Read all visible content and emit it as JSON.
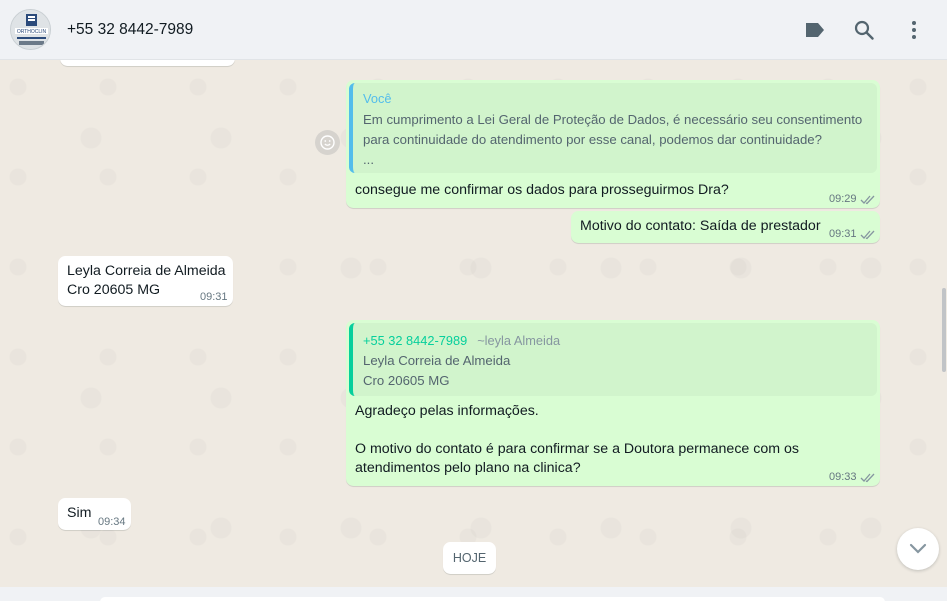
{
  "header": {
    "contact": "+55 32 8442-7989",
    "avatar_text": "ORTHOCLIN"
  },
  "messages": [
    {
      "quote_author": "Você",
      "quote_line1": "Em cumprimento a Lei Geral de Proteção de Dados, é necessário seu consentimento",
      "quote_line2": "para continuidade do atendimento por esse canal, podemos dar continuidade?",
      "quote_line3": "...",
      "text": "consegue me confirmar os dados para prosseguirmos Dra?",
      "time": "09:29"
    },
    {
      "text": "Motivo do contato: Saída de prestador",
      "time": "09:31"
    },
    {
      "line1": "Leyla Correia de Almeida",
      "line2": "Cro 20605 MG",
      "time": "09:31"
    },
    {
      "quote_author": "+55 32 8442-7989",
      "quote_sub": "~leyla Almeida",
      "quote_line1": "Leyla Correia de Almeida",
      "quote_line2": "Cro 20605 MG",
      "line1": "Agradeço pelas informações.",
      "line2": "O motivo do contato é para confirmar se a Doutora permanece com os",
      "line3": "atendimentos pelo plano na clinica?",
      "time": "09:33"
    },
    {
      "text": "Sim",
      "time": "09:34"
    }
  ],
  "date_divider": "HOJE",
  "icons": {
    "label": "label-icon",
    "search": "search-icon",
    "menu": "menu-icon",
    "react": "emoji-icon",
    "scroll_down": "chevron-down-icon"
  },
  "colors": {
    "outgoing_bubble": "#d9fdd3",
    "incoming_bubble": "#ffffff",
    "read_ticks": "#53bdeb",
    "sent_ticks": "#8696a0",
    "quote_you": "#53bdeb",
    "quote_contact": "#06cf9c"
  }
}
